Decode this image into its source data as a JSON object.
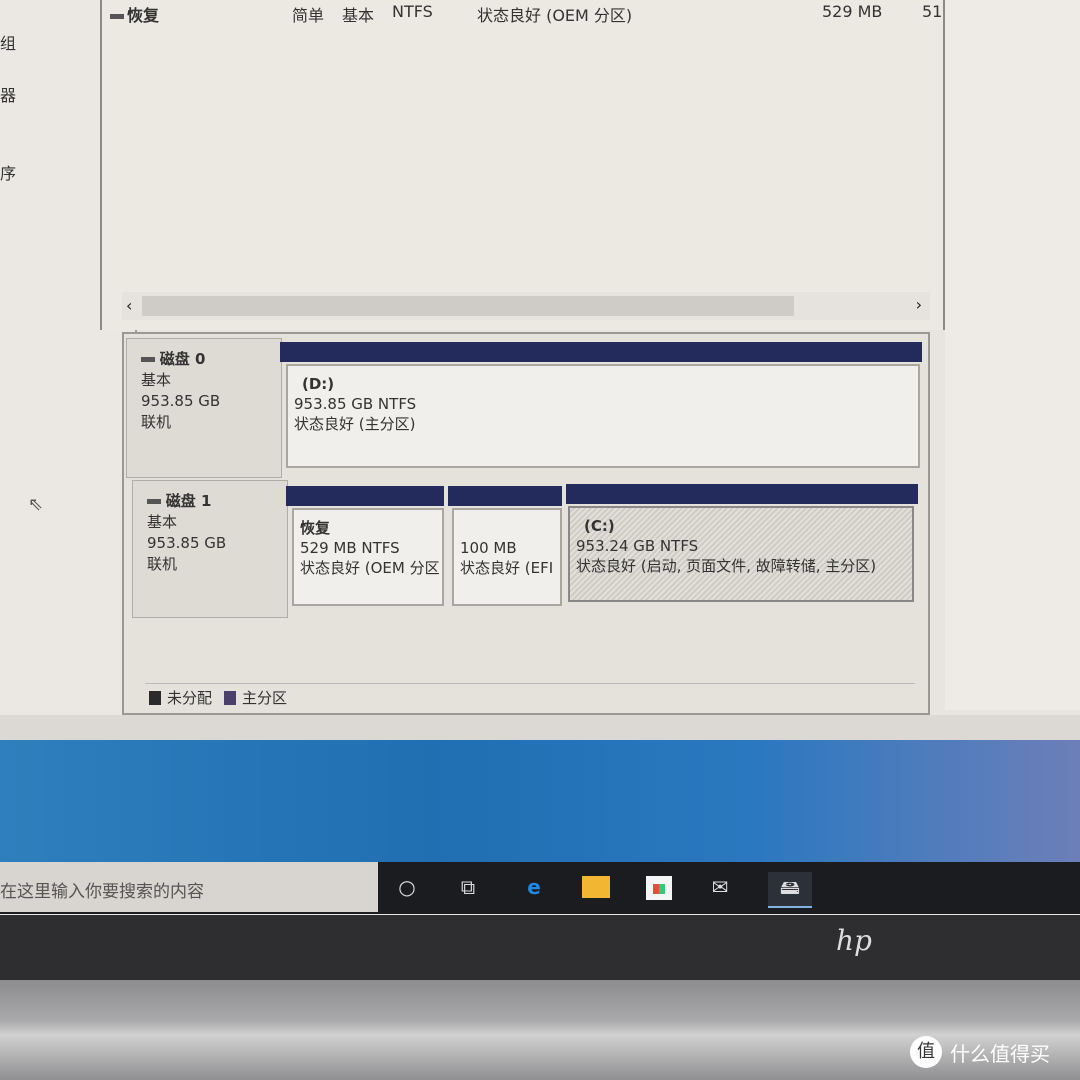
{
  "sidebar": {
    "items": [
      "组",
      "器",
      "序"
    ]
  },
  "volume_list": {
    "rows": [
      {
        "name": "恢复",
        "layout": "简单",
        "type": "基本",
        "fs": "NTFS",
        "status": "状态良好 (OEM 分区)",
        "capacity": "529 MB",
        "free": "51"
      }
    ],
    "scroll_left": "‹",
    "scroll_right": "›"
  },
  "disks": [
    {
      "name": "磁盘 0",
      "type": "基本",
      "size": "953.85 GB",
      "state": "联机",
      "partitions": [
        {
          "label": "(D:)",
          "size": "953.85 GB NTFS",
          "status": "状态良好 (主分区)"
        }
      ]
    },
    {
      "name": "磁盘 1",
      "type": "基本",
      "size": "953.85 GB",
      "state": "联机",
      "partitions": [
        {
          "label": "恢复",
          "size": "529 MB NTFS",
          "status": "状态良好 (OEM 分区"
        },
        {
          "label": "",
          "size": "100 MB",
          "status": "状态良好 (EFI"
        },
        {
          "label": "(C:)",
          "size": "953.24 GB NTFS",
          "status": "状态良好 (启动, 页面文件, 故障转储, 主分区)"
        }
      ]
    }
  ],
  "legend": [
    {
      "label": "未分配",
      "color": "#2a2a2a"
    },
    {
      "label": "主分区",
      "color": "#4b3f6b"
    }
  ],
  "taskbar": {
    "search_placeholder": "在这里输入你要搜索的内容",
    "icons": [
      "cortana-icon",
      "task-view-icon",
      "edge-icon",
      "file-explorer-icon",
      "store-icon",
      "mail-icon",
      "disk-management-icon"
    ]
  },
  "bezel": {
    "logo": "hp"
  },
  "watermark": {
    "badge": "值",
    "text": "什么值得买"
  },
  "colors": {
    "partition_bar": "#232a5c",
    "taskbar": "#1a1c20",
    "desktop": "#1f6fb2"
  }
}
